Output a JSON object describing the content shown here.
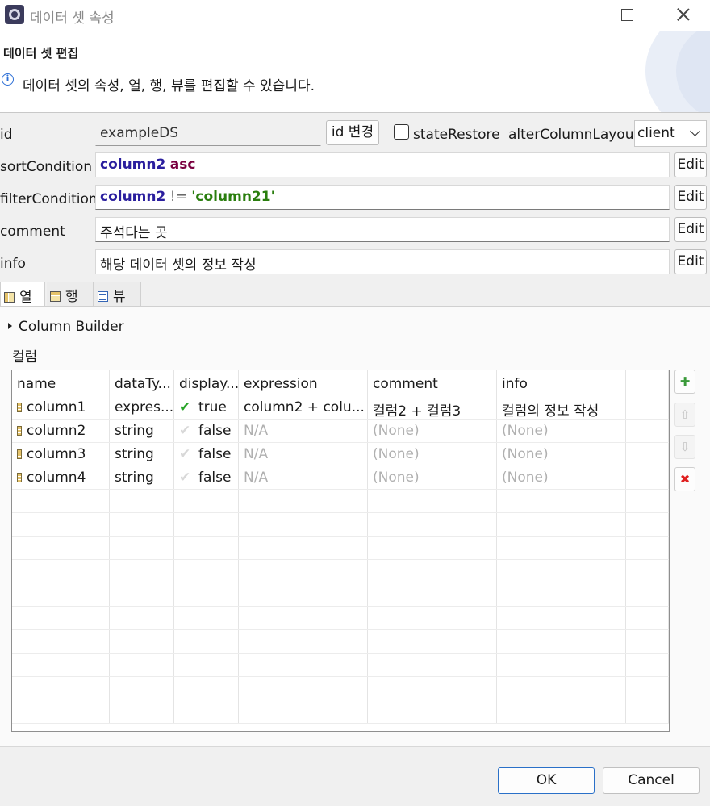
{
  "window": {
    "title": "데이터 셋 속성"
  },
  "header": {
    "title": "데이터 셋 편집",
    "description": "데이터 셋의 속성, 열, 행, 뷰를 편집할 수 있습니다."
  },
  "form": {
    "id_label": "id",
    "id_value": "exampleDS",
    "id_change_button": "id 변경",
    "state_restore_label": "stateRestore",
    "state_restore_checked": false,
    "alter_column_layout_label": "alterColumnLayout",
    "alter_column_layout_value": "client",
    "sort_condition_label": "sortCondition",
    "sort_condition": {
      "field": "column2",
      "order": "asc"
    },
    "filter_condition_label": "filterCondition",
    "filter_condition": {
      "field": "column2",
      "operator": "!=",
      "value": "'column21'"
    },
    "comment_label": "comment",
    "comment_value": "주석다는 곳",
    "info_label": "info",
    "info_value": "해당 데이터 셋의 정보 작성",
    "edit_label": "Edit"
  },
  "tabs": [
    {
      "label": "열",
      "active": true
    },
    {
      "label": "행",
      "active": false
    },
    {
      "label": "뷰",
      "active": false
    }
  ],
  "panel": {
    "column_builder_label": "Column Builder",
    "section_label": "컬럼"
  },
  "table": {
    "headers": [
      "name",
      "dataTy...",
      "display...",
      "expression",
      "comment",
      "info"
    ],
    "rows": [
      {
        "name": "column1",
        "dataType": "expres...",
        "display_checked": true,
        "display": "true",
        "expression": "column2 + colu...",
        "comment": "컬럼2 + 컬럼3",
        "info": "컬럼의 정보 작성"
      },
      {
        "name": "column2",
        "dataType": "string",
        "display_checked": false,
        "display": "false",
        "expression": "N/A",
        "comment": "(None)",
        "info": "(None)"
      },
      {
        "name": "column3",
        "dataType": "string",
        "display_checked": false,
        "display": "false",
        "expression": "N/A",
        "comment": "(None)",
        "info": "(None)"
      },
      {
        "name": "column4",
        "dataType": "string",
        "display_checked": false,
        "display": "false",
        "expression": "N/A",
        "comment": "(None)",
        "info": "(None)"
      }
    ]
  },
  "side_buttons": [
    {
      "icon": "add-column-icon",
      "glyph": "✚",
      "color": "#3a9a3a",
      "enabled": true
    },
    {
      "icon": "move-up-icon",
      "glyph": "⇧",
      "color": "#c4c4c4",
      "enabled": false
    },
    {
      "icon": "move-down-icon",
      "glyph": "⇩",
      "color": "#c4c4c4",
      "enabled": false
    },
    {
      "icon": "delete-icon",
      "glyph": "✖",
      "color": "#e02020",
      "enabled": true
    }
  ],
  "footer": {
    "ok_label": "OK",
    "cancel_label": "Cancel"
  }
}
